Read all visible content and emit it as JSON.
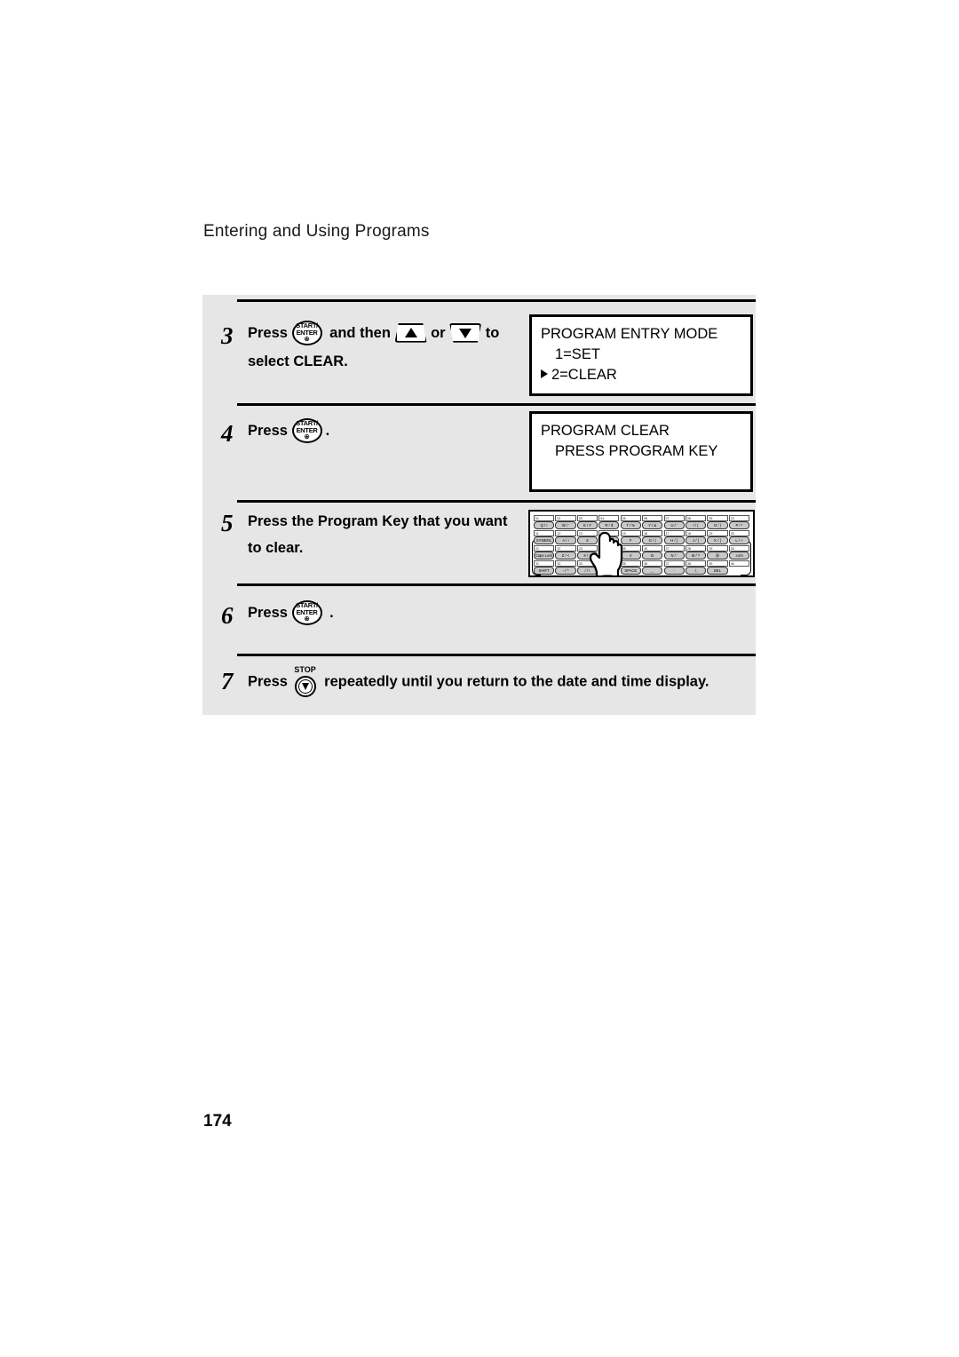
{
  "page": {
    "header": "Entering and Using Programs",
    "number": "174"
  },
  "steps": [
    {
      "num": "3",
      "line1_pre": "Press",
      "line1_mid": "and then",
      "line1_or": "or",
      "line1_post": "to",
      "line2": "select CLEAR.",
      "enter_key": {
        "label_top": "START/",
        "label_bottom": "ENTER",
        "glyph": "⏻"
      },
      "arrow_up": "up-arrow-key",
      "arrow_down": "down-arrow-key"
    },
    {
      "num": "4",
      "line1_pre": "Press",
      "line1_post": ".",
      "enter_key": {
        "label_top": "START/",
        "label_bottom": "ENTER",
        "glyph": "⏻"
      }
    },
    {
      "num": "5",
      "line1": "Press the Program Key that you want",
      "line2": "to clear."
    },
    {
      "num": "6",
      "line1_pre": "Press",
      "line1_post": ".",
      "enter_key": {
        "label_top": "START/",
        "label_bottom": "ENTER",
        "glyph": "⏻"
      }
    },
    {
      "num": "7",
      "line1_pre": "Press",
      "line1_post": "repeatedly until you return to the date and time display.",
      "stop_key": {
        "label": "STOP"
      }
    }
  ],
  "displays": [
    {
      "id": "program-entry-mode",
      "lines": [
        {
          "text": "PROGRAM ENTRY MODE",
          "indent": 0,
          "marker": false
        },
        {
          "text": "1=SET",
          "indent": 1,
          "marker": false
        },
        {
          "text": "2=CLEAR",
          "indent": 0,
          "marker": true
        }
      ]
    },
    {
      "id": "program-clear",
      "lines": [
        {
          "text": "PROGRAM CLEAR",
          "indent": 0,
          "marker": false
        },
        {
          "text": "PRESS PROGRAM KEY",
          "indent": 1,
          "marker": false
        }
      ]
    }
  ],
  "keyboard": {
    "rows": [
      {
        "slots": [
          "01",
          "02",
          "03",
          "04",
          "05",
          "06",
          "07",
          "08",
          "09",
          "10"
        ],
        "keys": [
          "Q / !",
          "W / '",
          "E / #",
          "R / $",
          "T / %",
          "Y / &",
          "U / '",
          "I / (",
          "O / )",
          "P / *"
        ]
      },
      {
        "slots": [
          "11",
          "12",
          "13",
          "14",
          "15",
          "16",
          "17",
          "18",
          "19",
          "20"
        ],
        "keys": [
          "SYMBOL",
          "A / !",
          "S",
          "D",
          "F",
          "G / {",
          "H / }",
          "J / [",
          "K / ]",
          "L / +"
        ]
      },
      {
        "slots": [
          "21",
          "22",
          "23",
          "24",
          "25",
          "26",
          "27",
          "28",
          "29",
          "30"
        ],
        "keys": [
          "Caps Lock",
          "Z / <",
          "X / >",
          "C",
          "V",
          "B",
          "N / '",
          "M / ?",
          "@",
          ".com"
        ]
      },
      {
        "slots": [
          "31",
          "32",
          "33",
          "34",
          "35",
          "36",
          "37",
          "38",
          "39",
          "40"
        ],
        "keys": [
          "SHIFT",
          "- / ^",
          "/ / \\",
          "; / :",
          "SPACE",
          "_",
          "-",
          ". / ,",
          "DEL",
          ""
        ]
      }
    ]
  },
  "colors": {
    "panel_bg": "#e6e6e6",
    "key_fill": "#c9c9c9",
    "line": "#000000",
    "lcd_bg": "#ffffff"
  }
}
